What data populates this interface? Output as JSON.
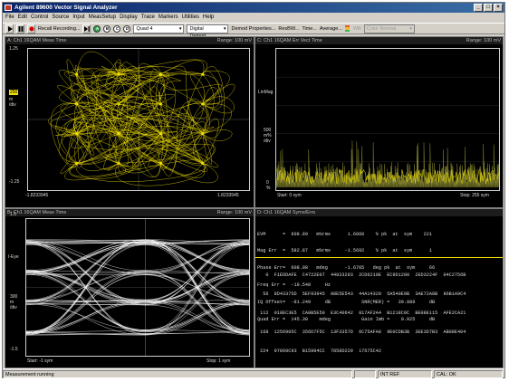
{
  "window": {
    "title": "Agilent 89600 Vector Signal Analyzer"
  },
  "menu": [
    "File",
    "Edit",
    "Control",
    "Source",
    "Input",
    "MeasSetup",
    "Display",
    "Trace",
    "Markers",
    "Utilities",
    "Help"
  ],
  "toolbar": {
    "recall_label": "Recall Recording...",
    "circle_buttons": [
      "A",
      "B",
      "C",
      "D"
    ],
    "quad_select": "Quad 4",
    "demod_select": "Digital Demod",
    "demod_properties": "Demod Properties...",
    "res_bw": "ResBW...",
    "time": "Time...",
    "average": "Average...",
    "wb": "WB",
    "color_select": "Color Normal"
  },
  "panes": {
    "a": {
      "title": "A: Ch1 16QAM Meas Time",
      "range": "Range: 100 mV",
      "y_top": "1.25",
      "y_mid_marker": "250",
      "y_mid_unit": "m",
      "y_mid_div": "/div",
      "y_bottom": "-1.25",
      "x_left": "-1.8233945",
      "x_right": "1.8233945"
    },
    "c": {
      "title": "C: Ch1 16QAM Err Vect Time",
      "range": "Range: 100 mV",
      "scale_label": "LinMag",
      "y_mid": "500",
      "y_unit": "m%",
      "y_div": "/div",
      "y_bottom": "0",
      "y_bottom_unit": "%",
      "x_left": "Start: 0  sym",
      "x_right": "Stop: 255  sym"
    },
    "b": {
      "title": "B: Ch1 16QAM Meas Time",
      "range": "Range: 100 mV",
      "y_top": "1.5",
      "y_eye": "I-Eye",
      "y_mid": "300",
      "y_mid_unit": "m",
      "y_mid_div": "/div",
      "y_bottom": "-1.5",
      "x_left": "Start: -1  sym",
      "x_right": "Stop: 1  sym"
    },
    "d": {
      "title": "D: Ch1 16QAM Syms/Errs",
      "stats": [
        "EVM      =  608.89   m%rms      1.6860    % pk  at  sym    221",
        "Mag Err  =  582.87   m%rms     -1.5692    % pk  at  sym      1",
        "Phase Err=  608.98   mdeg      -1.6705   deg pk  at  sym     66",
        "Freq Err =  -19.548     Hz",
        "IQ Offset=  -81.249     dB           SNR(MER) =   39.889     dB",
        "Quad Err =  145.30    mdeg           Gain Imb =    0.025     dB"
      ],
      "rows": [
        "   0  F1EDDAFE  C4722E07  44833293  2CD6210E  EC9D1200  2ED3224F  04C2756B",
        "  56  8D43375D  5EF93945  88E5E543  44A14320  5A540E9B  3AE72A8B  86B1A9C4",
        " 112  018EC3E5  CA8B5E50  E3C40642  817AF2A4  B1218C0C  BE08E115  AFE2CA21",
        " 168  1256905C  356D7F5C  13F3357D  6C75AFA0  9E0CDB3B  3EE3D7B3  AB08E404",
        " 224  97869C93  B15984CC  7858D229  17675C42"
      ]
    }
  },
  "status": {
    "message": "Measurement running",
    "ref": "INT REF",
    "cal": "CAL: OK"
  },
  "colors": {
    "trace_yellow": "#f0e000",
    "trace_white": "#ffffff",
    "trace_olive": "#7a7a2a"
  }
}
